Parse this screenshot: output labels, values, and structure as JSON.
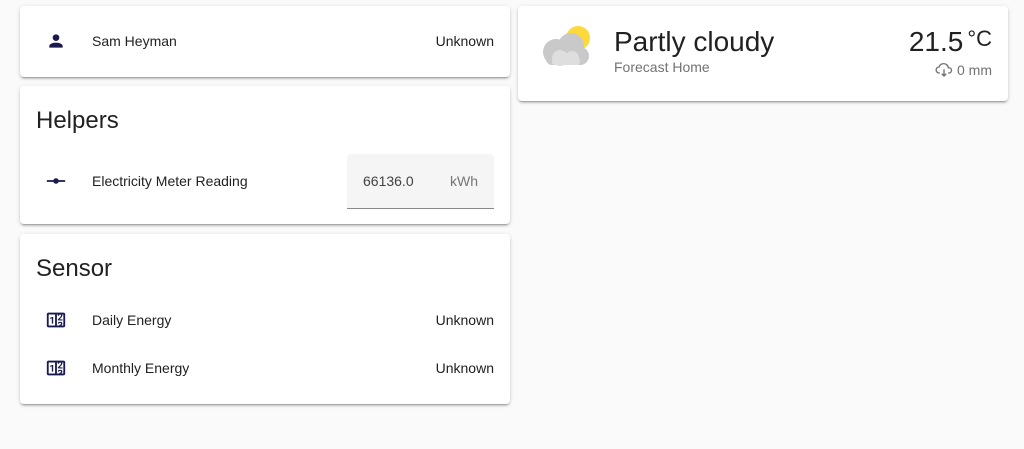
{
  "person_card": {
    "name": "Sam Heyman",
    "state": "Unknown",
    "icon": "account-icon"
  },
  "helpers_card": {
    "title": "Helpers",
    "entity": {
      "name": "Electricity Meter Reading",
      "icon": "ray-vertex-icon",
      "value": "66136.0",
      "unit": "kWh"
    }
  },
  "sensor_card": {
    "title": "Sensor",
    "entities": [
      {
        "name": "Daily Energy",
        "state": "Unknown",
        "icon": "counter-icon"
      },
      {
        "name": "Monthly Energy",
        "state": "Unknown",
        "icon": "counter-icon"
      }
    ]
  },
  "weather_card": {
    "condition": "Partly cloudy",
    "name": "Forecast Home",
    "temperature": "21.5",
    "temperature_unit": "°C",
    "precipitation": "0 mm",
    "icon": "partly-cloudy-icon"
  },
  "colors": {
    "background": "#fafafa",
    "card": "#ffffff",
    "icon": "#1a1a4e",
    "sun": "#fdd93c",
    "cloud": "#c9c9c9"
  }
}
